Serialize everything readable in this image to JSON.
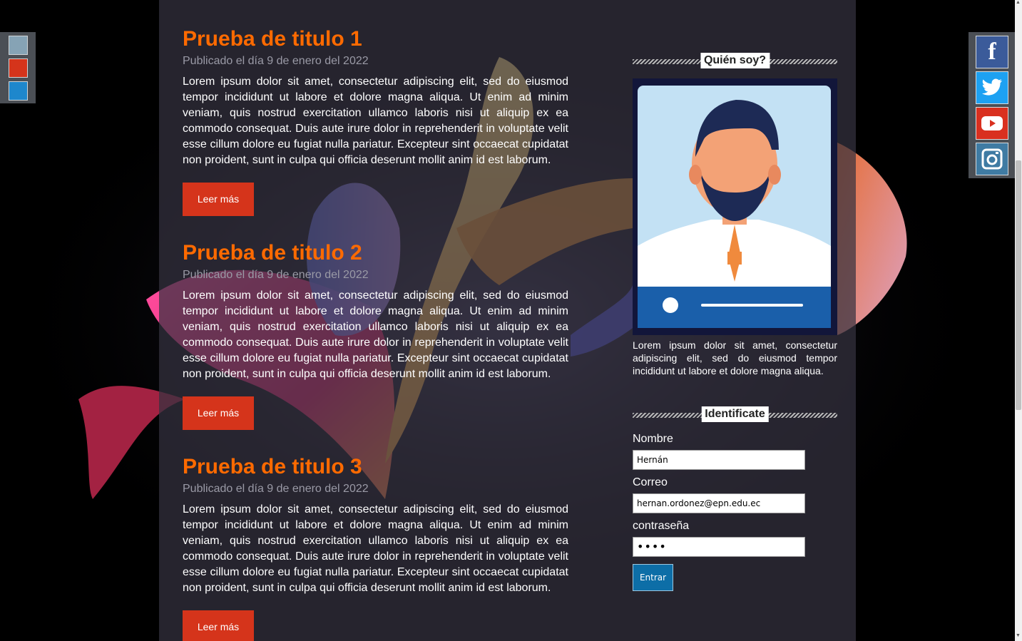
{
  "theme_swatches": [
    {
      "color": "#86a3b5"
    },
    {
      "color": "#d5341b"
    },
    {
      "color": "#1e87cc"
    }
  ],
  "social": [
    {
      "icon": "facebook-icon",
      "glyph": "f",
      "color": "#3b5b9a"
    },
    {
      "icon": "twitter-icon",
      "glyph": "🐦",
      "color": "#1da1f2"
    },
    {
      "icon": "youtube-icon",
      "glyph": "▶",
      "color": "#d9301f"
    },
    {
      "icon": "instagram-icon",
      "glyph": "◎",
      "color": "#3f7ba3"
    }
  ],
  "posts": [
    {
      "title": "Prueba de titulo 1",
      "date": "Publicado el día 9 de enero del 2022",
      "body": "Lorem ipsum dolor sit amet, consectetur adipiscing elit, sed do eiusmod tempor incididunt ut labore et dolore magna aliqua. Ut enim ad minim veniam, quis nostrud exercitation ullamco laboris nisi ut aliquip ex ea commodo consequat. Duis aute irure dolor in reprehenderit in voluptate velit esse cillum dolore eu fugiat nulla pariatur. Excepteur sint occaecat cupidatat non proident, sunt in culpa qui officia deserunt mollit anim id est laborum.",
      "button": "Leer más"
    },
    {
      "title": "Prueba de titulo 2",
      "date": "Publicado el día 9 de enero del 2022",
      "body": "Lorem ipsum dolor sit amet, consectetur adipiscing elit, sed do eiusmod tempor incididunt ut labore et dolore magna aliqua. Ut enim ad minim veniam, quis nostrud exercitation ullamco laboris nisi ut aliquip ex ea commodo consequat. Duis aute irure dolor in reprehenderit in voluptate velit esse cillum dolore eu fugiat nulla pariatur. Excepteur sint occaecat cupidatat non proident, sunt in culpa qui officia deserunt mollit anim id est laborum.",
      "button": "Leer más"
    },
    {
      "title": "Prueba de titulo 3",
      "date": "Publicado el día 9 de enero del 2022",
      "body": "Lorem ipsum dolor sit amet, consectetur adipiscing elit, sed do eiusmod tempor incididunt ut labore et dolore magna aliqua. Ut enim ad minim veniam, quis nostrud exercitation ullamco laboris nisi ut aliquip ex ea commodo consequat. Duis aute irure dolor in reprehenderit in voluptate velit esse cillum dolore eu fugiat nulla pariatur. Excepteur sint occaecat cupidatat non proident, sunt in culpa qui officia deserunt mollit anim id est laborum.",
      "button": "Leer más"
    }
  ],
  "sidebar": {
    "about": {
      "heading": "Quién soy?",
      "text": "Lorem ipsum dolor sit amet, consectetur adipiscing elit, sed do eiusmod tempor incididunt ut labore et dolore magna aliqua."
    },
    "login": {
      "heading": "Identificate",
      "name_label": "Nombre",
      "name_value": "Hernán",
      "email_label": "Correo",
      "email_value": "hernan.ordonez@epn.edu.ec",
      "password_label": "contraseña",
      "password_value": "••••",
      "submit": "Entrar"
    }
  },
  "colors": {
    "accent": "#ff6a00",
    "button": "#d5341b",
    "submit": "#0d6ea7"
  }
}
